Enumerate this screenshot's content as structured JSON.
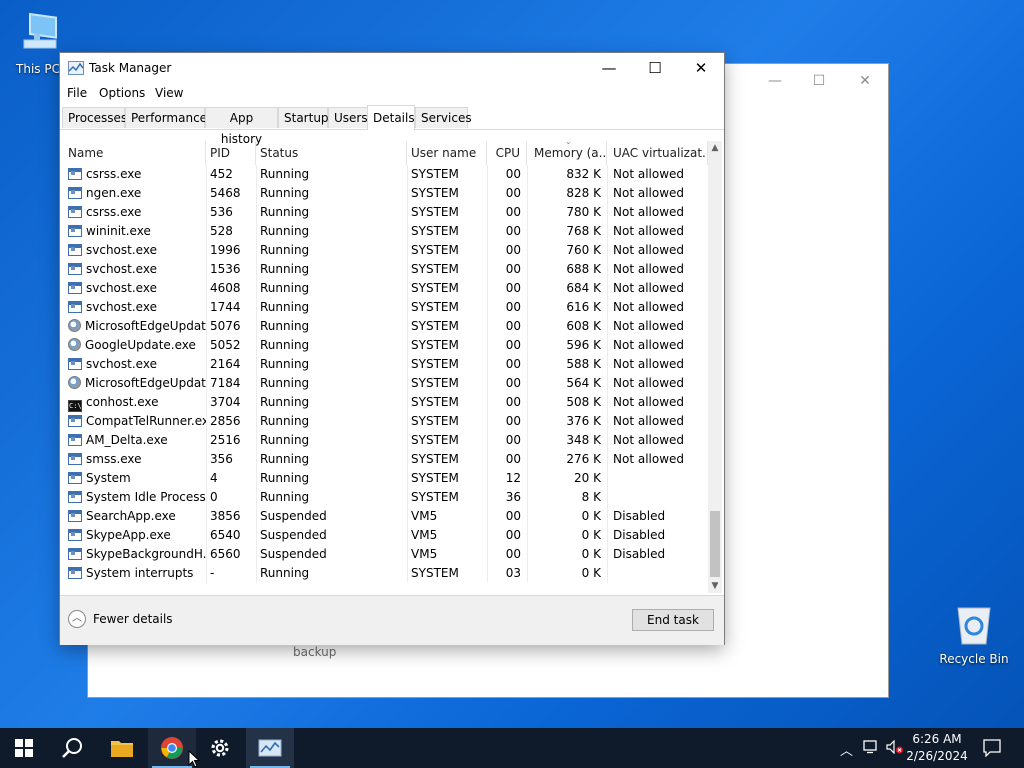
{
  "desktop": {
    "this_pc_label": "This PC",
    "recycle_bin_label": "Recycle Bin",
    "background_window_text": "backup"
  },
  "window": {
    "title": "Task Manager",
    "controls": {
      "minimize": "—",
      "maximize": "☐",
      "close": "✕"
    }
  },
  "menu": {
    "file": "File",
    "options": "Options",
    "view": "View"
  },
  "tabs": [
    {
      "label": "Processes"
    },
    {
      "label": "Performance"
    },
    {
      "label": "App history"
    },
    {
      "label": "Startup"
    },
    {
      "label": "Users"
    },
    {
      "label": "Details",
      "active": true
    },
    {
      "label": "Services"
    }
  ],
  "columns": [
    "Name",
    "PID",
    "Status",
    "User name",
    "CPU",
    "Memory (a...",
    "UAC virtualizat..."
  ],
  "processes": [
    {
      "icon": "win",
      "name": "csrss.exe",
      "pid": "452",
      "status": "Running",
      "user": "SYSTEM",
      "cpu": "00",
      "memory": "832 K",
      "uac": "Not allowed"
    },
    {
      "icon": "win",
      "name": "ngen.exe",
      "pid": "5468",
      "status": "Running",
      "user": "SYSTEM",
      "cpu": "00",
      "memory": "828 K",
      "uac": "Not allowed"
    },
    {
      "icon": "win",
      "name": "csrss.exe",
      "pid": "536",
      "status": "Running",
      "user": "SYSTEM",
      "cpu": "00",
      "memory": "780 K",
      "uac": "Not allowed"
    },
    {
      "icon": "win",
      "name": "wininit.exe",
      "pid": "528",
      "status": "Running",
      "user": "SYSTEM",
      "cpu": "00",
      "memory": "768 K",
      "uac": "Not allowed"
    },
    {
      "icon": "win",
      "name": "svchost.exe",
      "pid": "1996",
      "status": "Running",
      "user": "SYSTEM",
      "cpu": "00",
      "memory": "760 K",
      "uac": "Not allowed"
    },
    {
      "icon": "win",
      "name": "svchost.exe",
      "pid": "1536",
      "status": "Running",
      "user": "SYSTEM",
      "cpu": "00",
      "memory": "688 K",
      "uac": "Not allowed"
    },
    {
      "icon": "win",
      "name": "svchost.exe",
      "pid": "4608",
      "status": "Running",
      "user": "SYSTEM",
      "cpu": "00",
      "memory": "684 K",
      "uac": "Not allowed"
    },
    {
      "icon": "win",
      "name": "svchost.exe",
      "pid": "1744",
      "status": "Running",
      "user": "SYSTEM",
      "cpu": "00",
      "memory": "616 K",
      "uac": "Not allowed"
    },
    {
      "icon": "update",
      "name": "MicrosoftEdgeUpdat...",
      "pid": "5076",
      "status": "Running",
      "user": "SYSTEM",
      "cpu": "00",
      "memory": "608 K",
      "uac": "Not allowed"
    },
    {
      "icon": "update",
      "name": "GoogleUpdate.exe",
      "pid": "5052",
      "status": "Running",
      "user": "SYSTEM",
      "cpu": "00",
      "memory": "596 K",
      "uac": "Not allowed"
    },
    {
      "icon": "win",
      "name": "svchost.exe",
      "pid": "2164",
      "status": "Running",
      "user": "SYSTEM",
      "cpu": "00",
      "memory": "588 K",
      "uac": "Not allowed"
    },
    {
      "icon": "update",
      "name": "MicrosoftEdgeUpdat...",
      "pid": "7184",
      "status": "Running",
      "user": "SYSTEM",
      "cpu": "00",
      "memory": "564 K",
      "uac": "Not allowed"
    },
    {
      "icon": "console",
      "name": "conhost.exe",
      "pid": "3704",
      "status": "Running",
      "user": "SYSTEM",
      "cpu": "00",
      "memory": "508 K",
      "uac": "Not allowed"
    },
    {
      "icon": "win",
      "name": "CompatTelRunner.exe",
      "pid": "2856",
      "status": "Running",
      "user": "SYSTEM",
      "cpu": "00",
      "memory": "376 K",
      "uac": "Not allowed"
    },
    {
      "icon": "win",
      "name": "AM_Delta.exe",
      "pid": "2516",
      "status": "Running",
      "user": "SYSTEM",
      "cpu": "00",
      "memory": "348 K",
      "uac": "Not allowed"
    },
    {
      "icon": "win",
      "name": "smss.exe",
      "pid": "356",
      "status": "Running",
      "user": "SYSTEM",
      "cpu": "00",
      "memory": "276 K",
      "uac": "Not allowed"
    },
    {
      "icon": "win",
      "name": "System",
      "pid": "4",
      "status": "Running",
      "user": "SYSTEM",
      "cpu": "12",
      "memory": "20 K",
      "uac": ""
    },
    {
      "icon": "win",
      "name": "System Idle Process",
      "pid": "0",
      "status": "Running",
      "user": "SYSTEM",
      "cpu": "36",
      "memory": "8 K",
      "uac": ""
    },
    {
      "icon": "win",
      "name": "SearchApp.exe",
      "pid": "3856",
      "status": "Suspended",
      "user": "VM5",
      "cpu": "00",
      "memory": "0 K",
      "uac": "Disabled"
    },
    {
      "icon": "win",
      "name": "SkypeApp.exe",
      "pid": "6540",
      "status": "Suspended",
      "user": "VM5",
      "cpu": "00",
      "memory": "0 K",
      "uac": "Disabled"
    },
    {
      "icon": "win",
      "name": "SkypeBackgroundH...",
      "pid": "6560",
      "status": "Suspended",
      "user": "VM5",
      "cpu": "00",
      "memory": "0 K",
      "uac": "Disabled"
    },
    {
      "icon": "win",
      "name": "System interrupts",
      "pid": "-",
      "status": "Running",
      "user": "SYSTEM",
      "cpu": "03",
      "memory": "0 K",
      "uac": ""
    }
  ],
  "footer": {
    "fewer_details": "Fewer details",
    "end_task": "End task"
  },
  "taskbar": {
    "apps": [
      "start-icon",
      "search-icon",
      "file-explorer-icon",
      "chrome-icon",
      "settings-icon",
      "task-manager-icon"
    ],
    "clock_time": "6:26 AM",
    "clock_date": "2/26/2024"
  },
  "colors": {
    "desktop_blue": "#1f7de8",
    "taskbar": "#0f1a2b",
    "accent": "#76b9ed"
  }
}
